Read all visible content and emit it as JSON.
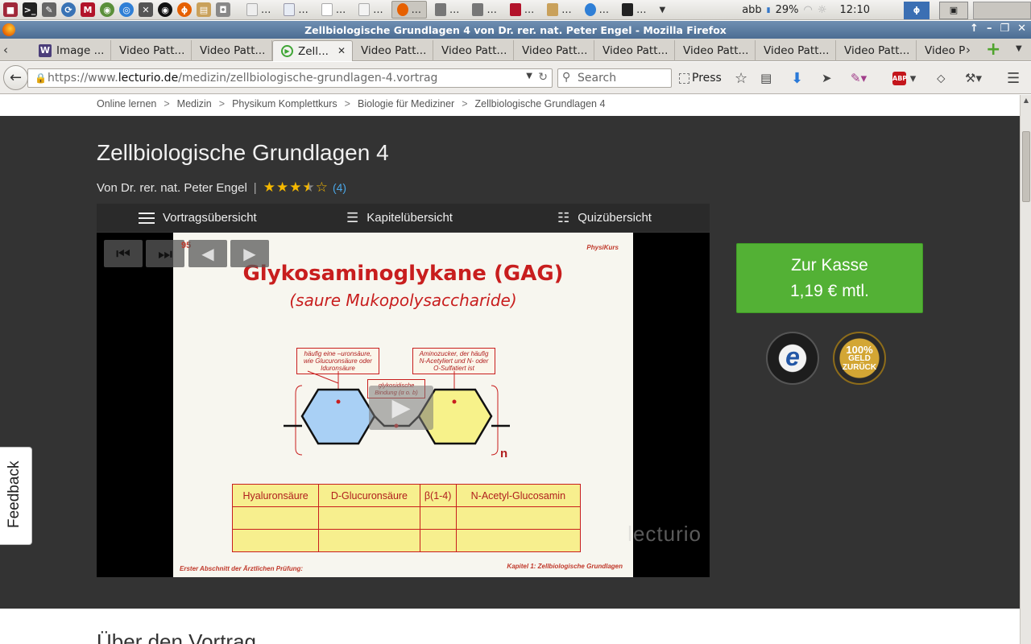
{
  "taskbar": {
    "tasks": [
      "...",
      "...",
      "...",
      "...",
      "...",
      "...",
      "...",
      "...",
      "...",
      "..."
    ],
    "keyboard_layout": "abb",
    "battery": "29%",
    "clock": "12:10"
  },
  "window": {
    "title": "Zellbiologische Grundlagen 4 von Dr. rer. nat. Peter Engel - Mozilla Firefox"
  },
  "tabs": [
    {
      "label": "Image ...",
      "active": false
    },
    {
      "label": "Video Patt...",
      "active": false
    },
    {
      "label": "Video Patt...",
      "active": false
    },
    {
      "label": "Zell...",
      "active": true
    },
    {
      "label": "Video Patt...",
      "active": false
    },
    {
      "label": "Video Patt...",
      "active": false
    },
    {
      "label": "Video Patt...",
      "active": false
    },
    {
      "label": "Video Patt...",
      "active": false
    },
    {
      "label": "Video Patt...",
      "active": false
    },
    {
      "label": "Video Patt...",
      "active": false
    },
    {
      "label": "Video Patt...",
      "active": false
    },
    {
      "label": "Video P",
      "active": false
    }
  ],
  "navbar": {
    "url_prefix": "https://www.",
    "url_domain": "lecturio.de",
    "url_path": "/medizin/zellbiologische-grundlagen-4.vortrag",
    "search_placeholder": "Search",
    "press_label": "Press"
  },
  "breadcrumb": [
    "Online lernen",
    "Medizin",
    "Physikum Komplettkurs",
    "Biologie für Mediziner",
    "Zellbiologische Grundlagen 4"
  ],
  "lecture": {
    "title": "Zellbiologische Grundlagen 4",
    "author": "Von Dr. rer. nat. Peter Engel",
    "rating_stars": 3.5,
    "rating_count": "(4)"
  },
  "player_tabs": {
    "overview": "Vortragsübersicht",
    "chapters": "Kapitelübersicht",
    "quiz": "Quizübersicht"
  },
  "slide": {
    "number": "95",
    "brand": "PhysiKurs",
    "title": "Glykosaminoglykane (GAG)",
    "subtitle": "(saure Mukopolysaccharide)",
    "label_left": "häufig eine –uronsäure, wie Glucuronsäure oder Iduronsäure",
    "label_right": "Aminozucker, der häufig N-Acetyliert und N- oder O-Sulfatiert ist",
    "label_bond": "glykosidische Bindung (α o. b)",
    "repeat_n": "n",
    "table_row": [
      "Hyaluronsäure",
      "D-Glucuronsäure",
      "β(1-4)",
      "N-Acetyl-Glucosamin"
    ],
    "footer_left": "Erster Abschnitt der Ärztlichen Prüfung:",
    "footer_right": "Kapitel 1: Zellbiologische Grundlagen",
    "watermark": "lecturio"
  },
  "checkout": {
    "label": "Zur Kasse",
    "price": "1,19 € mtl."
  },
  "badges": {
    "trusted_shops": "TRUSTED SHOPS GUARANTEE",
    "money_back_top": "100%",
    "money_back_bottom": "GELD ZURÜCK"
  },
  "feedback_label": "Feedback",
  "about_heading": "Über den Vortrag",
  "colors": {
    "hero_bg": "#333333",
    "checkout_green": "#53b135",
    "slide_red": "#c81e1e",
    "star_gold": "#f5b800"
  }
}
